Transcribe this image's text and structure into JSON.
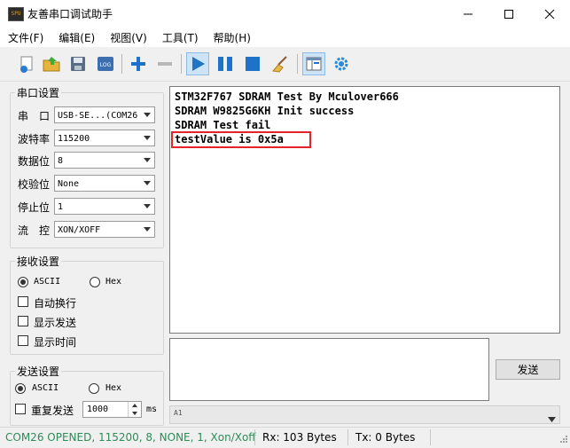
{
  "window": {
    "title": "友善串口调试助手",
    "app_icon_text": "SPU"
  },
  "menu": [
    "文件(F)",
    "编辑(E)",
    "视图(V)",
    "工具(T)",
    "帮助(H)"
  ],
  "toolbar": {
    "log_label": "LOG"
  },
  "serial_settings": {
    "title": "串口设置",
    "port_label": "串　口",
    "port_value": "USB-SE...(COM26",
    "baud_label": "波特率",
    "baud_value": "115200",
    "databits_label": "数据位",
    "databits_value": "8",
    "parity_label": "校验位",
    "parity_value": "None",
    "stopbits_label": "停止位",
    "stopbits_value": "1",
    "flow_label": "流　控",
    "flow_value": "XON/XOFF"
  },
  "receive_settings": {
    "title": "接收设置",
    "ascii_label": "ASCII",
    "hex_label": "Hex",
    "auto_wrap_label": "自动换行",
    "show_send_label": "显示发送",
    "show_time_label": "显示时间"
  },
  "send_settings": {
    "title": "发送设置",
    "ascii_label": "ASCII",
    "hex_label": "Hex",
    "repeat_label": "重复发送",
    "interval_value": "1000",
    "unit_label": "ms"
  },
  "receive_text": [
    "STM32F767 SDRAM Test By Mculover666",
    "SDRAM W9825G6KH Init success",
    "SDRAM Test fail",
    "testValue is 0x5a"
  ],
  "send_button_label": "发送",
  "send_history_value": "A1",
  "status": {
    "connection": "COM26 OPENED, 115200, 8, NONE, 1, Xon/Xoff",
    "rx": "Rx: 103 Bytes",
    "tx": "Tx: 0 Bytes"
  },
  "colors": {
    "status_connection": "#2e8b57",
    "highlight_box": "#e5242a",
    "toolbar_blue": "#1e73c8"
  }
}
